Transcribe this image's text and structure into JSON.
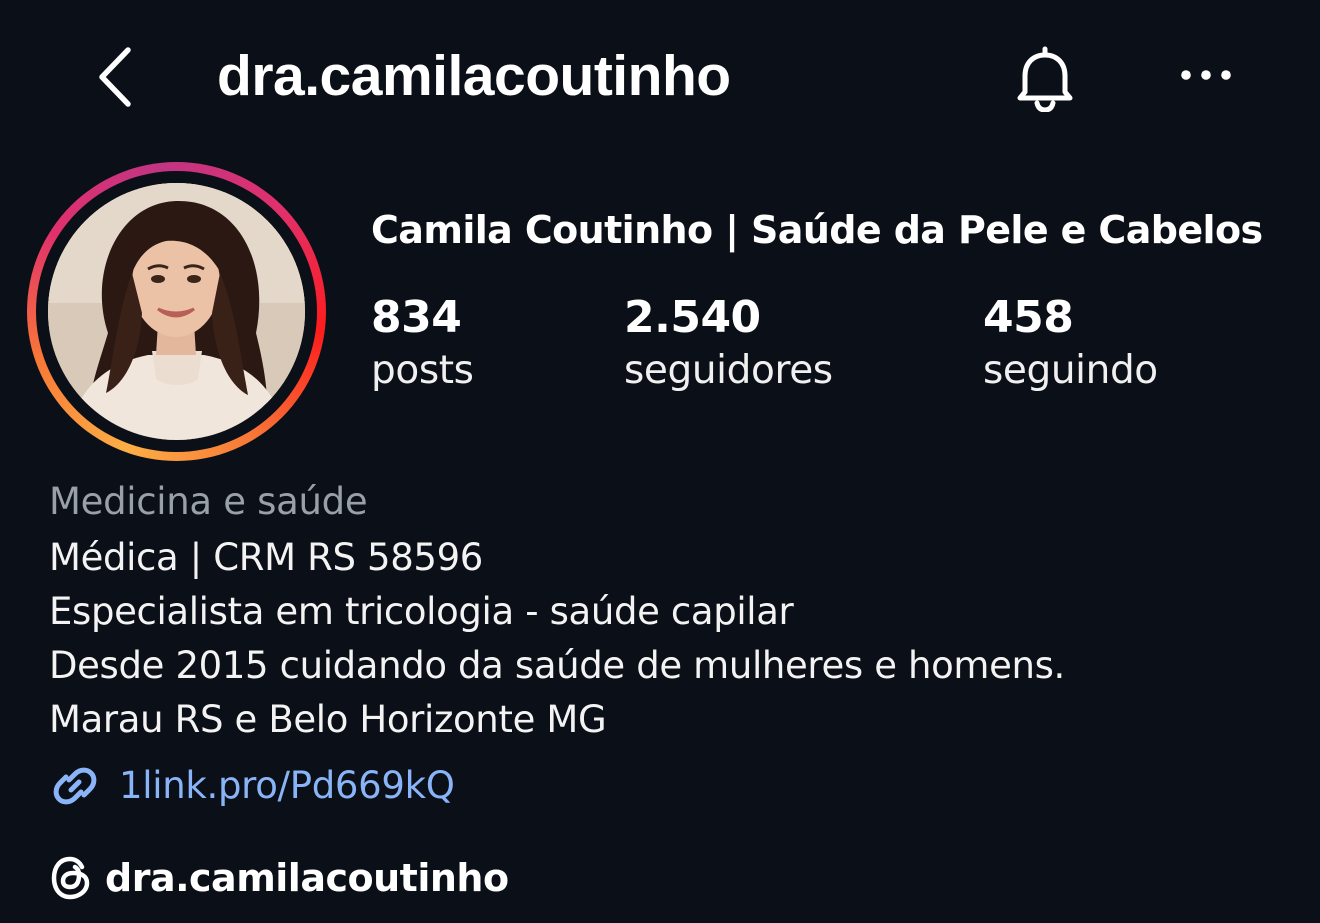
{
  "header": {
    "username": "dra.camilacoutinho",
    "back_icon": "chevron-left-icon",
    "bell_icon": "bell-icon",
    "more_icon": "more-horizontal-icon"
  },
  "profile": {
    "display_name": "Camila Coutinho | Saúde da Pele e Cabelos",
    "avatar_ring_colors": [
      "#fcaf45",
      "#f77737",
      "#e1306c",
      "#c13584"
    ]
  },
  "stats": [
    {
      "value": "834",
      "label": "posts"
    },
    {
      "value": "2.540",
      "label": "seguidores"
    },
    {
      "value": "458",
      "label": "seguindo"
    }
  ],
  "bio": {
    "category": "Medicina e saúde",
    "lines": [
      "Médica | CRM RS 58596",
      "Especialista em tricologia - saúde capilar",
      "Desde 2015 cuidando da saúde de mulheres e homens.",
      "Marau RS e Belo Horizonte MG"
    ],
    "link_icon": "link-icon",
    "link": "1link.pro/Pd669kQ",
    "link_color": "#8ab4f8",
    "threads_icon": "threads-icon",
    "threads_handle": "dra.camilacoutinho"
  },
  "theme": {
    "background": "#0b0f17",
    "text": "#ffffff",
    "muted": "#9aa0a8"
  }
}
